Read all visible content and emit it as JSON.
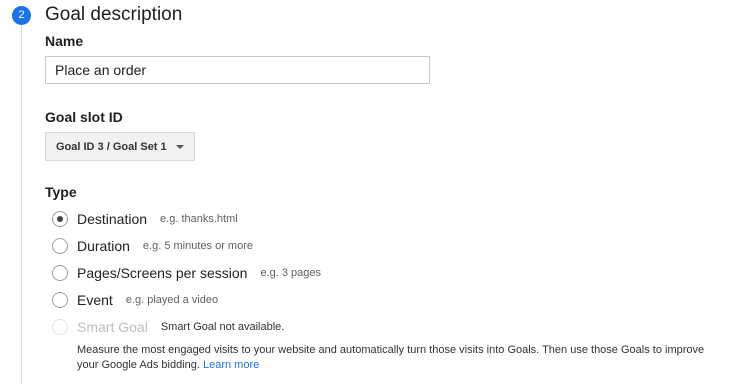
{
  "step": {
    "number": "2",
    "title": "Goal description"
  },
  "name_field": {
    "label": "Name",
    "value": "Place an order"
  },
  "goal_slot": {
    "label": "Goal slot ID",
    "selected": "Goal ID 3 / Goal Set 1"
  },
  "type": {
    "label": "Type",
    "options": [
      {
        "label": "Destination",
        "hint": "e.g. thanks.html",
        "checked": true,
        "disabled": false
      },
      {
        "label": "Duration",
        "hint": "e.g. 5 minutes or more",
        "checked": false,
        "disabled": false
      },
      {
        "label": "Pages/Screens per session",
        "hint": "e.g. 3 pages",
        "checked": false,
        "disabled": false
      },
      {
        "label": "Event",
        "hint": "e.g. played a video",
        "checked": false,
        "disabled": false
      },
      {
        "label": "Smart Goal",
        "hint": "Smart Goal not available.",
        "checked": false,
        "disabled": true
      }
    ],
    "smart_goal_description": "Measure the most engaged visits to your website and automatically turn those visits into Goals. Then use those Goals to improve your Google Ads bidding.",
    "learn_more": "Learn more"
  },
  "colors": {
    "accent": "#1a73e8",
    "disabled_text": "#bdbdbd"
  }
}
